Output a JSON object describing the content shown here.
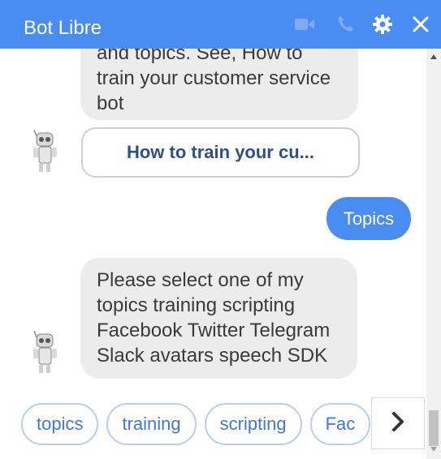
{
  "header": {
    "title": "Bot Libre",
    "icons": [
      "video-icon",
      "phone-icon",
      "gear-icon",
      "close-icon"
    ]
  },
  "messages": {
    "first_bot_text": "and topics.  See, How to train your customer service bot",
    "first_bot_lines": [
      "and topics.  See, How to",
      "train your customer service",
      "bot"
    ],
    "link_button": "How to train your cu...",
    "user_text": "Topics",
    "second_bot_lines": [
      "Please select one of my",
      "topics training scripting",
      "Facebook Twitter Telegram",
      "Slack avatars speech SDK"
    ]
  },
  "chips": [
    "topics",
    "training",
    "scripting",
    "Fac"
  ],
  "colors": {
    "header": "#4a8df2",
    "user_bubble": "#4a8df2",
    "bot_bubble": "#ececec",
    "chip_text": "#3d78d8",
    "link_text": "#2f4f87"
  }
}
